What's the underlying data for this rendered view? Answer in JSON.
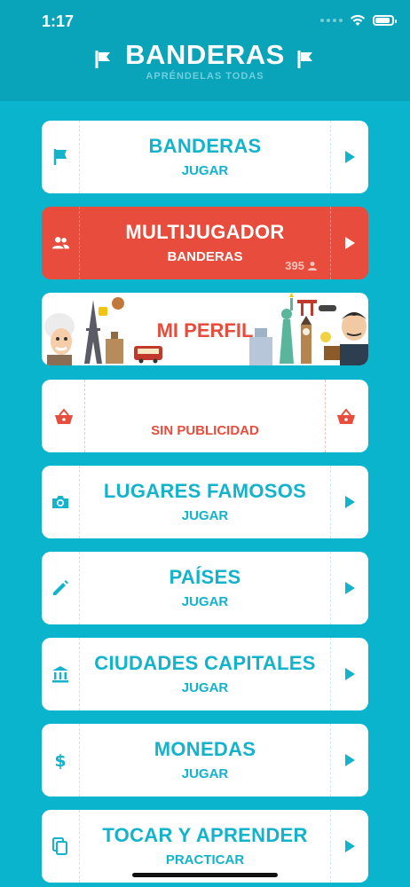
{
  "status": {
    "time": "1:17"
  },
  "header": {
    "title": "BANDERAS",
    "subtitle": "APRÉNDELAS TODAS"
  },
  "menu": {
    "banderas": {
      "title": "BANDERAS",
      "sub": "JUGAR"
    },
    "multijugador": {
      "title": "MULTIJUGADOR",
      "sub": "BANDERAS",
      "online_count": "395"
    },
    "perfil": {
      "title": "MI PERFIL"
    },
    "ads": {
      "sub": "SIN PUBLICIDAD"
    },
    "lugares": {
      "title": "LUGARES FAMOSOS",
      "sub": "JUGAR"
    },
    "paises": {
      "title": "PAÍSES",
      "sub": "JUGAR"
    },
    "capitales": {
      "title": "CIUDADES CAPITALES",
      "sub": "JUGAR"
    },
    "monedas": {
      "title": "MONEDAS",
      "sub": "JUGAR"
    },
    "tocar": {
      "title": "TOCAR Y APRENDER",
      "sub": "PRACTICAR"
    }
  },
  "colors": {
    "background": "#0ab4cc",
    "header": "#09a3ba",
    "accent_text": "#13b3cc",
    "red": "#e74c3c"
  },
  "icons": {
    "banderas": "flag-icon",
    "multijugador": "group-icon",
    "ads": "basket-icon",
    "lugares": "camera-icon",
    "paises": "pencil-icon",
    "capitales": "bank-icon",
    "monedas": "dollar-icon",
    "tocar": "copy-icon",
    "arrow": "play-arrow-icon"
  }
}
